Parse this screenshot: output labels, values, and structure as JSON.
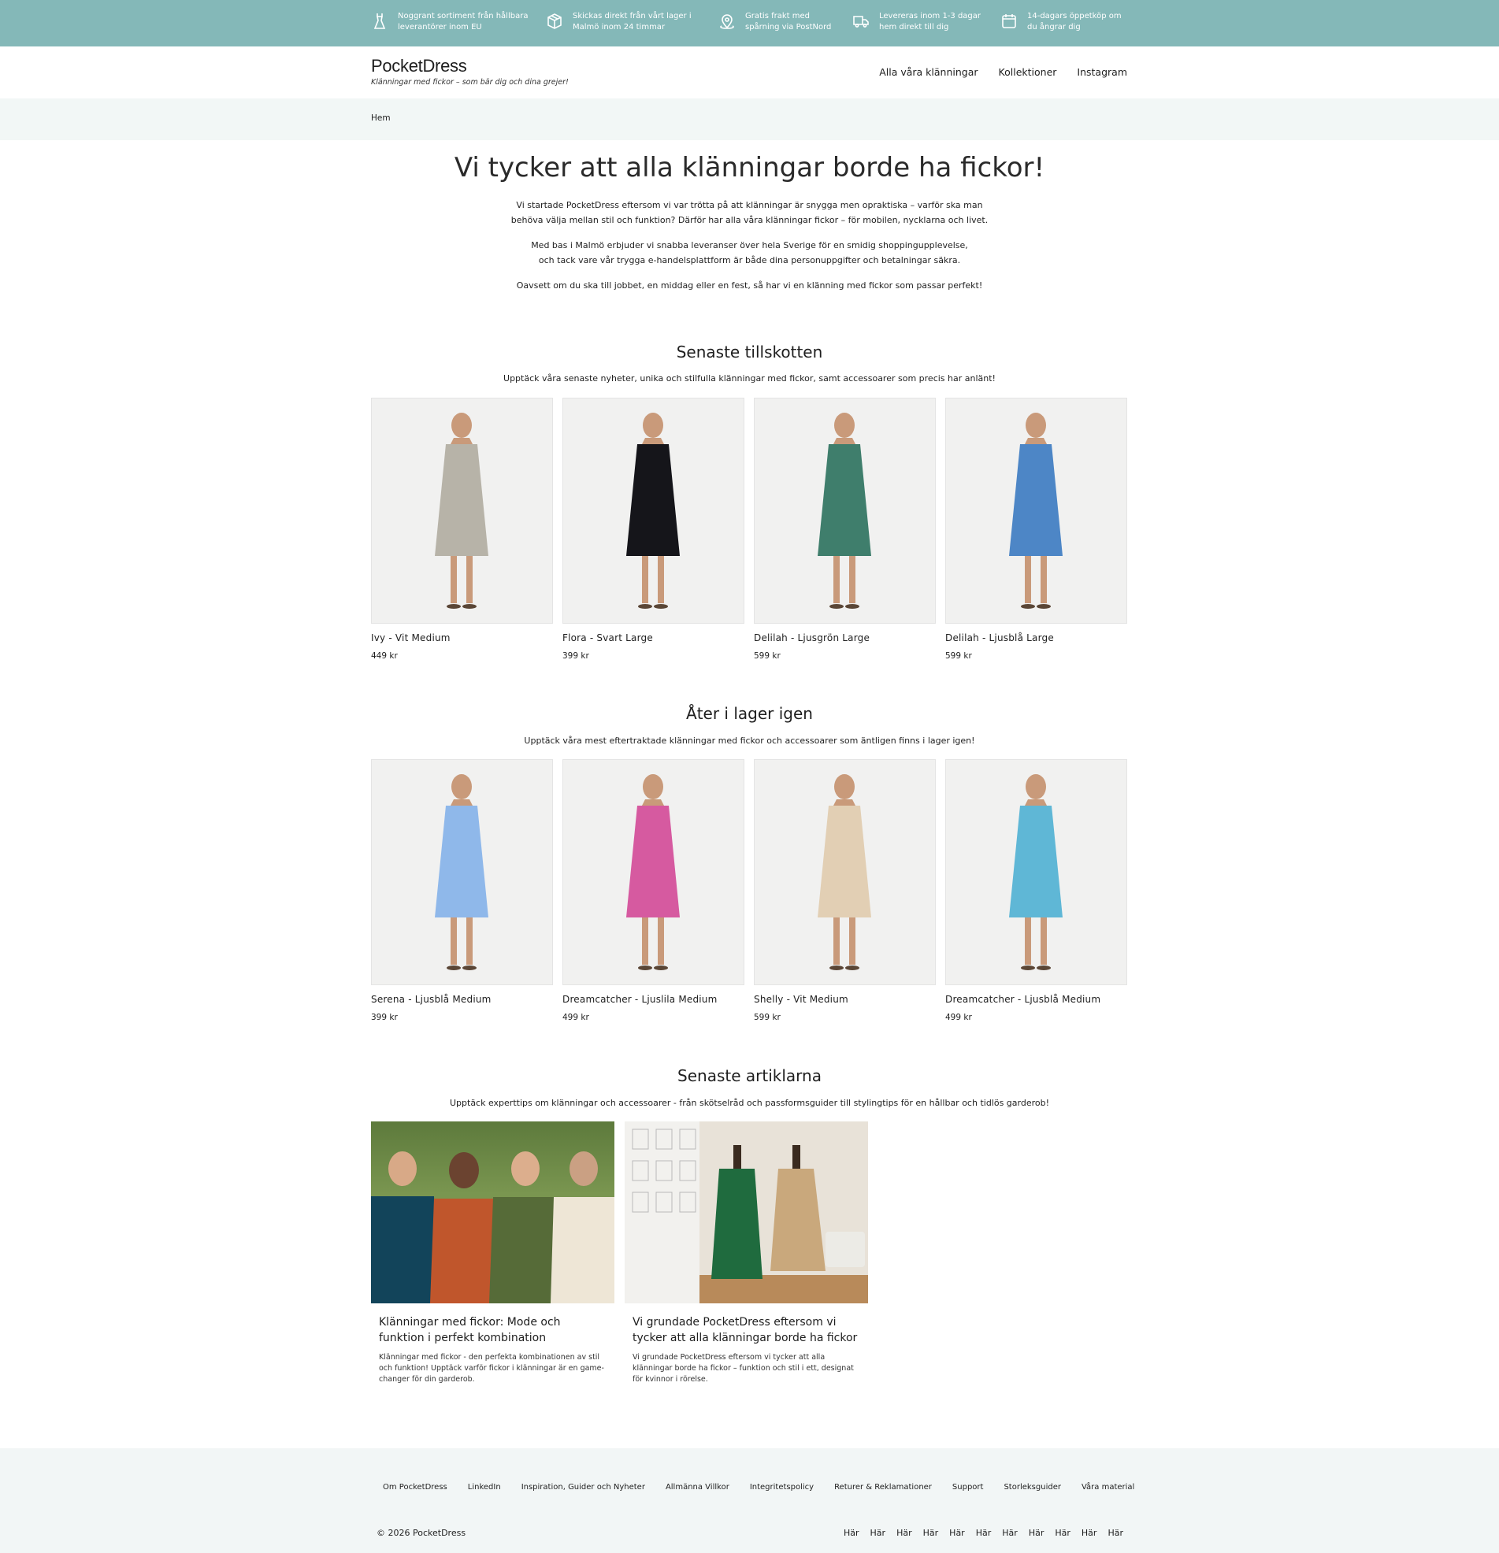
{
  "benefits": [
    {
      "icon": "dress-icon",
      "text": "Noggrant sortiment från hållbara\nleverantörer inom EU"
    },
    {
      "icon": "box-icon",
      "text": "Skickas direkt från vårt lager i\nMalmö inom 24 timmar"
    },
    {
      "icon": "location-pin-icon",
      "text": "Gratis frakt med\nspårning via PostNord"
    },
    {
      "icon": "truck-icon",
      "text": "Levereras inom 1-3 dagar\nhem direkt till dig"
    },
    {
      "icon": "calendar-icon",
      "text": "14-dagars öppetköp om\ndu ångrar dig"
    }
  ],
  "brand": {
    "name": "PocketDress",
    "tagline": "Klänningar med fickor – som bär dig och dina grejer!"
  },
  "nav": [
    "Alla våra klänningar",
    "Kollektioner",
    "Instagram"
  ],
  "breadcrumb": "Hem",
  "hero": {
    "title": "Vi tycker att alla klänningar borde ha fickor!",
    "p1": "Vi startade PocketDress eftersom vi var trötta på att klänningar är snygga men opraktiska – varför ska man\nbehöva välja mellan stil och funktion? Därför har alla våra klänningar fickor – för mobilen, nycklarna och livet.",
    "p2": "Med bas i Malmö erbjuder vi snabba leveranser över hela Sverige för en smidig shoppingupplevelse,\noch tack vare vår trygga e-handelsplattform är både dina personuppgifter och betalningar säkra.",
    "p3": "Oavsett om du ska till jobbet, en middag eller en fest, så har vi en klänning med fickor som passar perfekt!"
  },
  "latest": {
    "title": "Senaste tillskotten",
    "subtitle": "Upptäck våra senaste nyheter, unika och stilfulla klänningar med fickor, samt accessoarer som precis har anlänt!",
    "products": [
      {
        "name": "Ivy - Vit Medium",
        "price": "449 kr",
        "color": "#b7b3a8"
      },
      {
        "name": "Flora - Svart Large",
        "price": "399 kr",
        "color": "#15151a"
      },
      {
        "name": "Delilah - Ljusgrön Large",
        "price": "599 kr",
        "color": "#3f7e6c"
      },
      {
        "name": "Delilah - Ljusblå Large",
        "price": "599 kr",
        "color": "#4d86c6"
      }
    ]
  },
  "restock": {
    "title": "Åter i lager igen",
    "subtitle": "Upptäck våra mest eftertraktade klänningar med fickor och accessoarer som äntligen finns i lager igen!",
    "products": [
      {
        "name": "Serena - Ljusblå Medium",
        "price": "399 kr",
        "color": "#8fb8ea"
      },
      {
        "name": "Dreamcatcher - Ljuslila Medium",
        "price": "499 kr",
        "color": "#d65aa0"
      },
      {
        "name": "Shelly - Vit Medium",
        "price": "599 kr",
        "color": "#e2cfb4"
      },
      {
        "name": "Dreamcatcher - Ljusblå Medium",
        "price": "499 kr",
        "color": "#5fb7d6"
      }
    ]
  },
  "articles": {
    "title": "Senaste artiklarna",
    "subtitle": "Upptäck experttips om klänningar och accessoarer - från skötselråd och passformsguider till stylingtips för en hållbar och tidlös garderob!",
    "items": [
      {
        "title": "Klänningar med fickor: Mode och funktion i perfekt kombination",
        "excerpt": "Klänningar med fickor - den perfekta kombinationen av stil och funktion! Upptäck varför fickor i klänningar är en game-changer för din garderob."
      },
      {
        "title": "Vi grundade PocketDress eftersom vi tycker att alla klänningar borde ha fickor",
        "excerpt": "Vi grundade PocketDress eftersom vi tycker att alla klänningar borde ha fickor – funktion och stil i ett, designat för kvinnor i rörelse."
      }
    ]
  },
  "footer": {
    "links": [
      "Om PocketDress",
      "LinkedIn",
      "Inspiration, Guider och Nyheter",
      "Allmänna Villkor",
      "Integritetspolicy",
      "Returer & Reklamationer",
      "Support",
      "Storleksguider",
      "Våra material"
    ],
    "copyright": "© 2026 PocketDress",
    "har": [
      "Här",
      "Här",
      "Här",
      "Här",
      "Här",
      "Här",
      "Här",
      "Här",
      "Här",
      "Här",
      "Här"
    ]
  },
  "colors": {
    "topbar": "#84b8b8",
    "breadcrumb_bg": "#f2f7f6",
    "footer_bg": "#f2f6f6"
  }
}
